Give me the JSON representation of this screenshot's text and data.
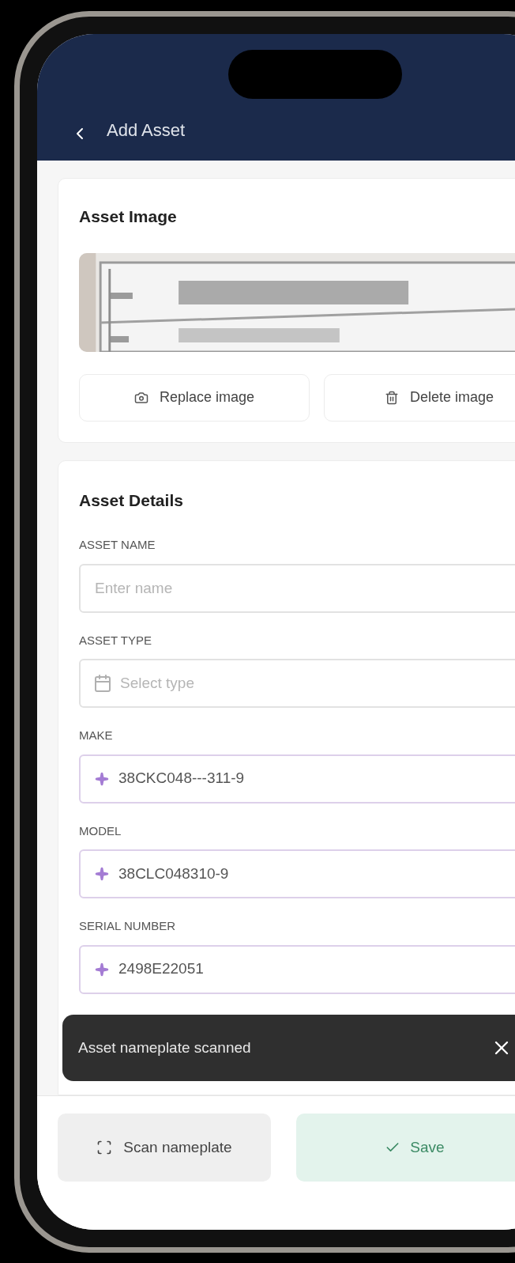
{
  "header": {
    "title": "Add Asset"
  },
  "image_card": {
    "title": "Asset Image",
    "actions": [
      {
        "label": "Replace image",
        "kind": "replace"
      },
      {
        "label": "Delete image",
        "kind": "delete"
      }
    ]
  },
  "details_card": {
    "title": "Asset Details",
    "fields": [
      {
        "label": "ASSET NAME",
        "kind": "text",
        "placeholder": "Enter name"
      },
      {
        "label": "ASSET TYPE",
        "kind": "select",
        "placeholder": "Select type"
      },
      {
        "label": "MAKE",
        "kind": "scanned",
        "value": "38CKC048---311-9"
      },
      {
        "label": "MODEL",
        "kind": "scanned",
        "value": "38CLC048310-9"
      },
      {
        "label": "SERIAL NUMBER",
        "kind": "scanned",
        "value": "2498E22051"
      }
    ]
  },
  "toast": {
    "message": "Asset nameplate scanned"
  },
  "bottom_bar": {
    "buttons": [
      {
        "label": "Scan nameplate",
        "kind": "secondary"
      },
      {
        "label": "Save",
        "kind": "primary"
      }
    ]
  }
}
